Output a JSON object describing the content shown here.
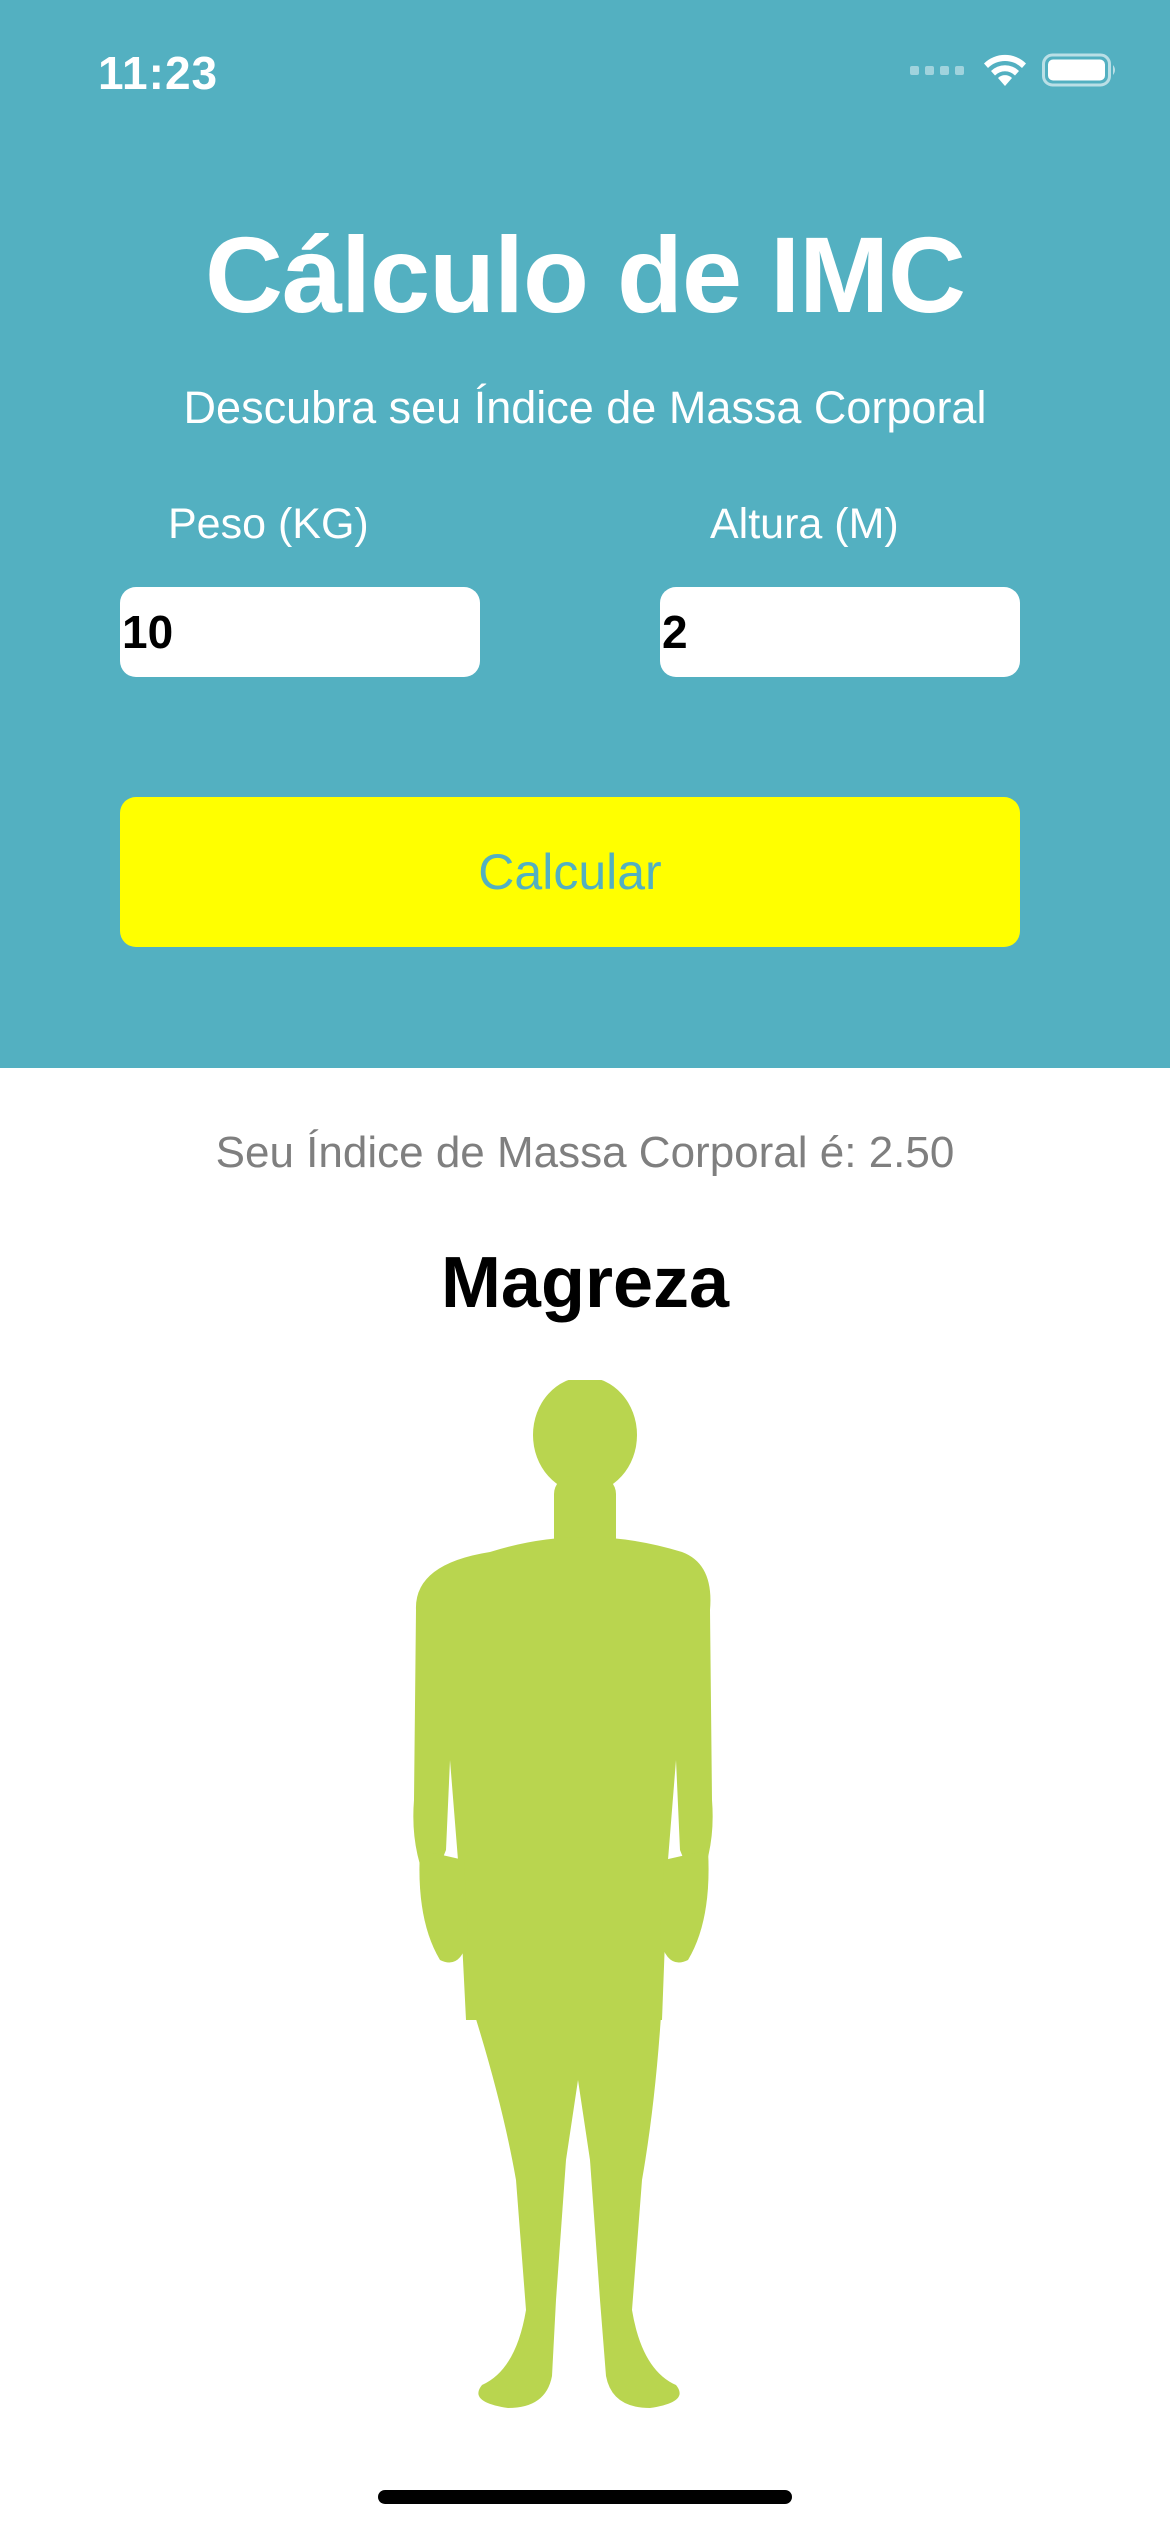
{
  "status_bar": {
    "time": "11:23",
    "icons": [
      "signal-icon",
      "wifi-icon",
      "battery-icon"
    ]
  },
  "header": {
    "title": "Cálculo de IMC",
    "subtitle": "Descubra seu Índice de Massa Corporal"
  },
  "form": {
    "weight_label": "Peso (KG)",
    "weight_value": "10",
    "height_label": "Altura (M)",
    "height_value": "2",
    "button_label": "Calcular"
  },
  "result": {
    "text": "Seu Índice de Massa Corporal é: 2.50",
    "category": "Magreza",
    "figure_icon": "body-silhouette-icon"
  },
  "colors": {
    "header_background": "#53b0c1",
    "button_background": "#ffff00",
    "button_text": "#53b0c1",
    "figure": "#b9d54f",
    "result_text": "#7f7f7f"
  }
}
